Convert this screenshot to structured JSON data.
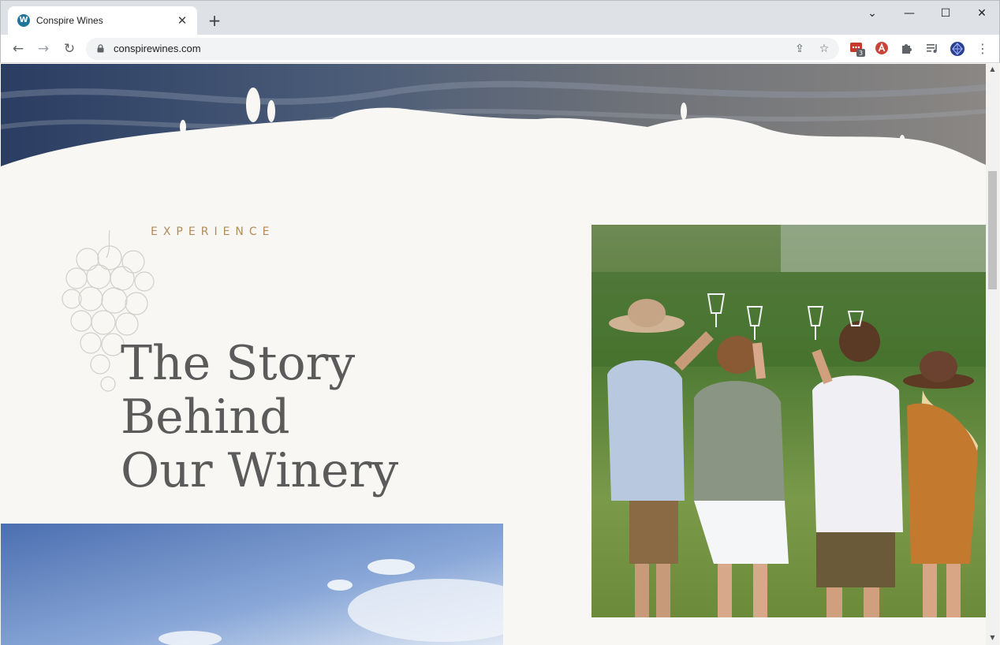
{
  "browser": {
    "tab_title": "Conspire Wines",
    "tab_close": "✕",
    "new_tab": "+",
    "url": "conspirewines.com",
    "window_controls": {
      "dropdown": "⌄",
      "minimize": "—",
      "maximize": "☐",
      "close": "✕"
    },
    "nav": {
      "back": "←",
      "forward": "→",
      "reload": "↻"
    },
    "omnibox_icons": {
      "share": "⇪",
      "bookmark": "☆"
    },
    "extensions": {
      "badge_count": "3",
      "menu": "⋮"
    }
  },
  "page": {
    "section_label": "EXPERIENCE",
    "headline": {
      "line1": "The Story Behind",
      "line2": "Our Winery"
    }
  },
  "colors": {
    "accent": "#b08b5b",
    "heading": "#5b5b5b",
    "background": "#f8f7f4"
  },
  "icons": {
    "favicon": "wordpress-icon",
    "lock": "lock-icon",
    "extensions": [
      "extension-badge-icon",
      "extension-a-icon",
      "puzzle-icon",
      "media-control-icon",
      "profile-icon"
    ]
  }
}
